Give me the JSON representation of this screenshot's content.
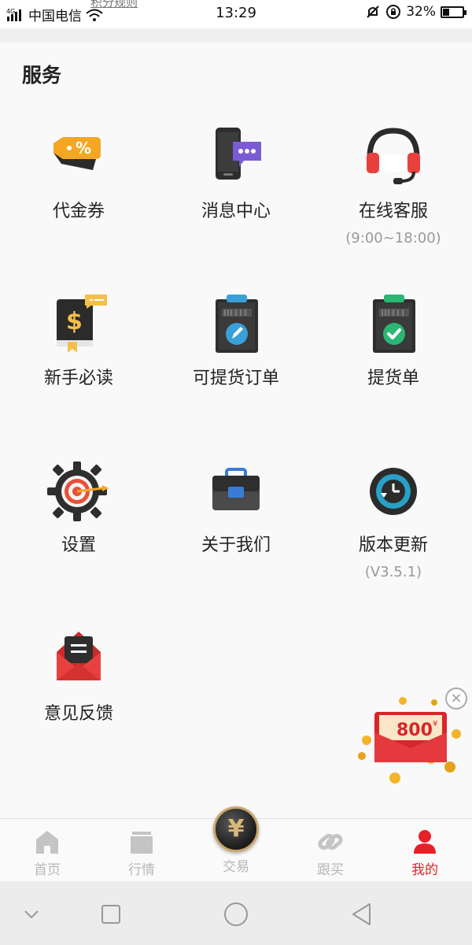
{
  "status_bar": {
    "network": "4G",
    "carrier": "中国电信",
    "time": "13:29",
    "battery": "32%",
    "ghost_text": "积分规则"
  },
  "services": {
    "title": "服务",
    "items": [
      {
        "label": "代金券",
        "sub": "",
        "icon": "coupon-icon"
      },
      {
        "label": "消息中心",
        "sub": "",
        "icon": "message-center-icon"
      },
      {
        "label": "在线客服",
        "sub": "(9:00~18:00)",
        "icon": "headset-icon"
      },
      {
        "label": "新手必读",
        "sub": "",
        "icon": "beginner-guide-icon"
      },
      {
        "label": "可提货订单",
        "sub": "",
        "icon": "pickup-order-clipboard-icon"
      },
      {
        "label": "提货单",
        "sub": "",
        "icon": "pickup-list-clipboard-icon"
      },
      {
        "label": "设置",
        "sub": "",
        "icon": "settings-gear-icon"
      },
      {
        "label": "关于我们",
        "sub": "",
        "icon": "briefcase-icon"
      },
      {
        "label": "版本更新",
        "sub": "(V3.5.1)",
        "icon": "clock-update-icon"
      },
      {
        "label": "意见反馈",
        "sub": "",
        "icon": "feedback-envelope-icon"
      }
    ]
  },
  "float_ad": {
    "amount": "800",
    "currency": "¥",
    "close": "×"
  },
  "tabbar": {
    "tabs": [
      {
        "label": "首页",
        "active": false
      },
      {
        "label": "行情",
        "active": false
      },
      {
        "label": "交易",
        "active": false
      },
      {
        "label": "跟买",
        "active": false
      },
      {
        "label": "我的",
        "active": true
      }
    ],
    "trade_symbol": "¥"
  },
  "colors": {
    "accent_red": "#e8202a",
    "inactive_gray": "#b7b7b7",
    "gold": "#c8a56a"
  }
}
